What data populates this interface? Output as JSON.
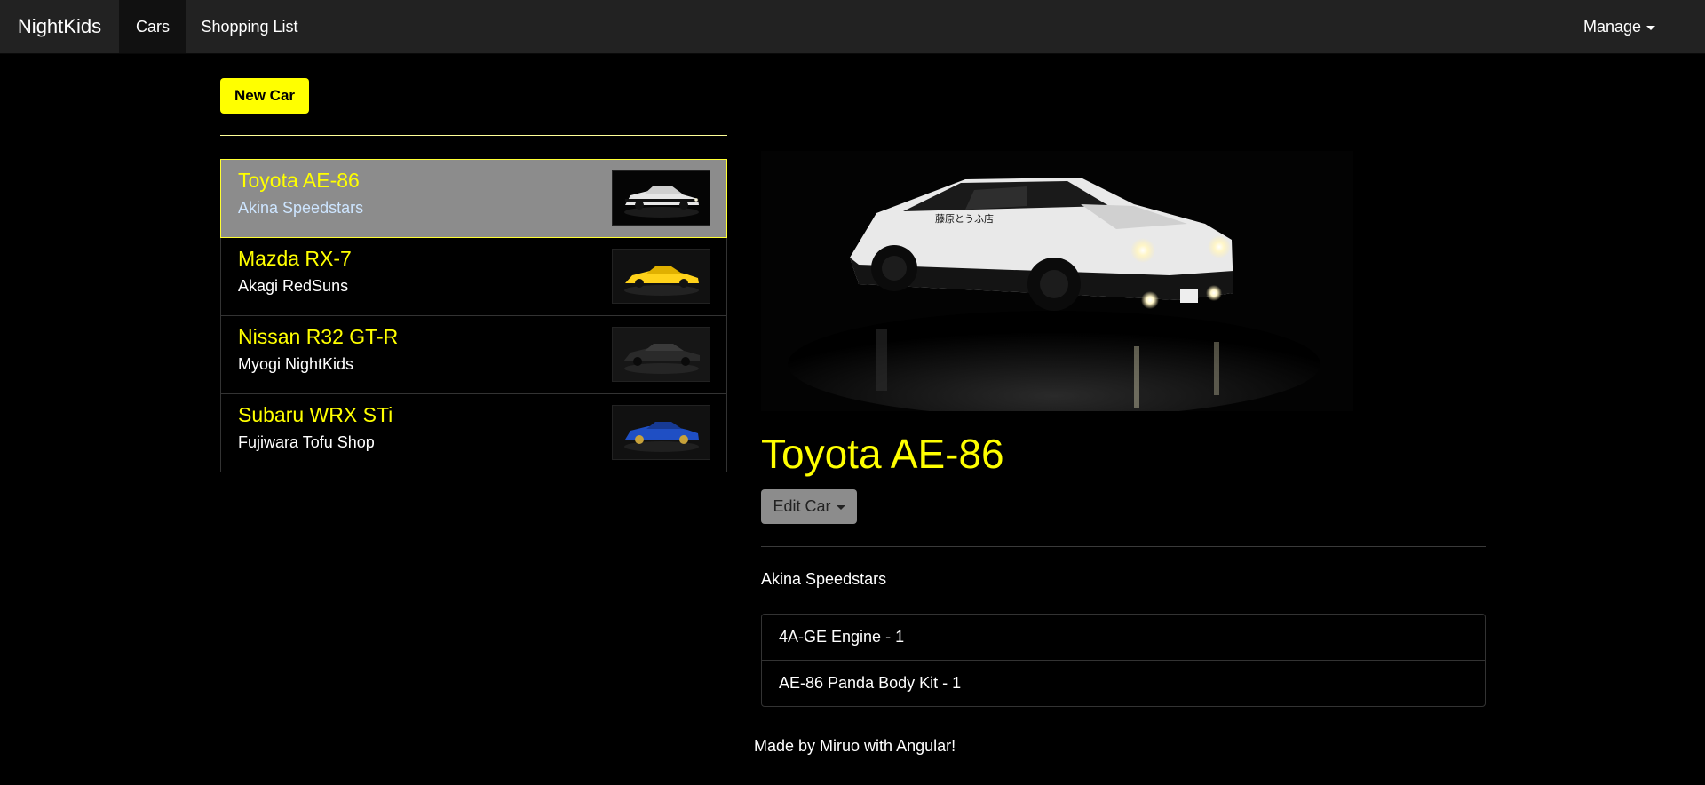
{
  "navbar": {
    "brand": "NightKids",
    "items": [
      {
        "label": "Cars"
      },
      {
        "label": "Shopping List"
      }
    ],
    "manage": "Manage"
  },
  "actions": {
    "new_car_label": "New Car"
  },
  "cars": [
    {
      "name": "Toyota AE-86",
      "team": "Akina Speedstars",
      "color": "#e6e6e6",
      "active": true
    },
    {
      "name": "Mazda RX-7",
      "team": "Akagi RedSuns",
      "color": "#ffd21a",
      "active": false
    },
    {
      "name": "Nissan R32 GT-R",
      "team": "Myogi NightKids",
      "color": "#2a2a2a",
      "active": false
    },
    {
      "name": "Subaru WRX STi",
      "team": "Fujiwara Tofu Shop",
      "color": "#1f4fc4",
      "active": false
    }
  ],
  "detail": {
    "title": "Toyota AE-86",
    "edit_label": "Edit Car",
    "team": "Akina Speedstars",
    "ingredients": [
      "4A-GE Engine - 1",
      "AE-86 Panda Body Kit - 1"
    ]
  },
  "footer": "Made by Miruo with Angular!",
  "colors": {
    "accent": "#ffff00",
    "navbar_bg": "#222222",
    "page_bg": "#000000",
    "active_item_bg": "#8c8c8c"
  }
}
